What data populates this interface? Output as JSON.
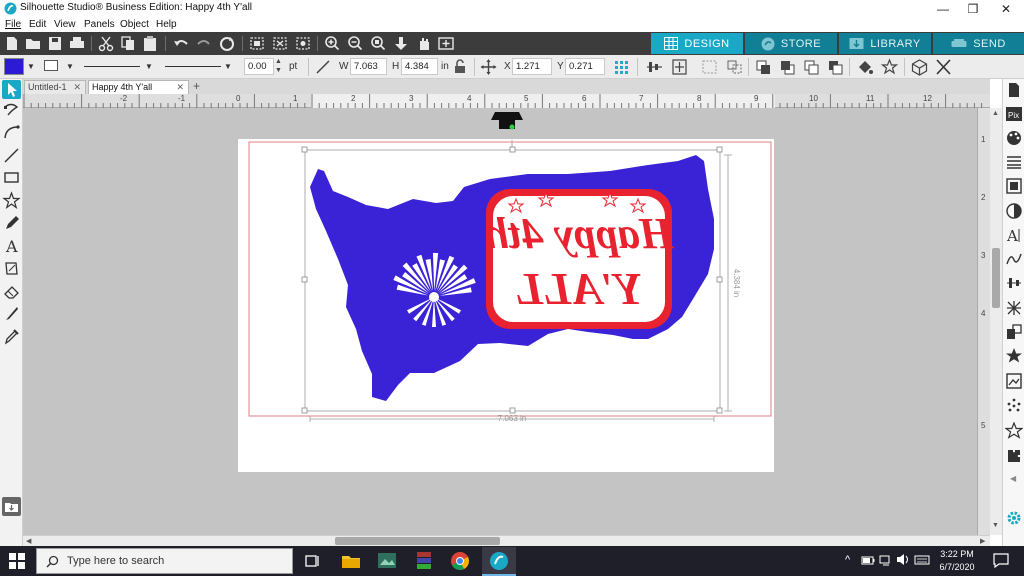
{
  "window": {
    "title": "Silhouette Studio® Business Edition: Happy 4th Y'all",
    "controls": [
      "—",
      "❐",
      "✕"
    ]
  },
  "menu": [
    "File",
    "Edit",
    "View",
    "Panels",
    "Object",
    "Help"
  ],
  "nav_tabs": [
    {
      "label": "DESIGN",
      "icon": "grid-icon"
    },
    {
      "label": "STORE",
      "icon": "store-icon"
    },
    {
      "label": "LIBRARY",
      "icon": "library-icon"
    },
    {
      "label": "SEND",
      "icon": "send-icon"
    }
  ],
  "props": {
    "fill_color": "#2d1bd4",
    "line_width": "0.00",
    "line_unit": "pt",
    "w_label": "W",
    "w_value": "7.063",
    "h_label": "H",
    "h_value": "4.384",
    "h_unit": "in",
    "x_label": "X",
    "x_value": "1.271",
    "y_label": "Y",
    "y_value": "0.271"
  },
  "doc_tabs": [
    {
      "label": "Untitled-1",
      "active": false
    },
    {
      "label": "Happy 4th Y'all",
      "active": true
    }
  ],
  "ruler_h": [
    "-2",
    "-1",
    "0",
    "1",
    "2",
    "3",
    "4",
    "5",
    "6",
    "7",
    "8",
    "9",
    "10",
    "11",
    "12"
  ],
  "ruler_v": [
    "1",
    "2",
    "3",
    "4",
    "5"
  ],
  "design": {
    "text_line1": "Happy 4th",
    "text_line2": "Y'ALL",
    "width_dim": "7.063 in",
    "height_dim": "4.384 in",
    "map_color": "#3a22d6",
    "text_color": "#e8222e"
  },
  "taskbar": {
    "search_placeholder": "Type here to search",
    "time": "3:22 PM",
    "date": "6/7/2020"
  }
}
